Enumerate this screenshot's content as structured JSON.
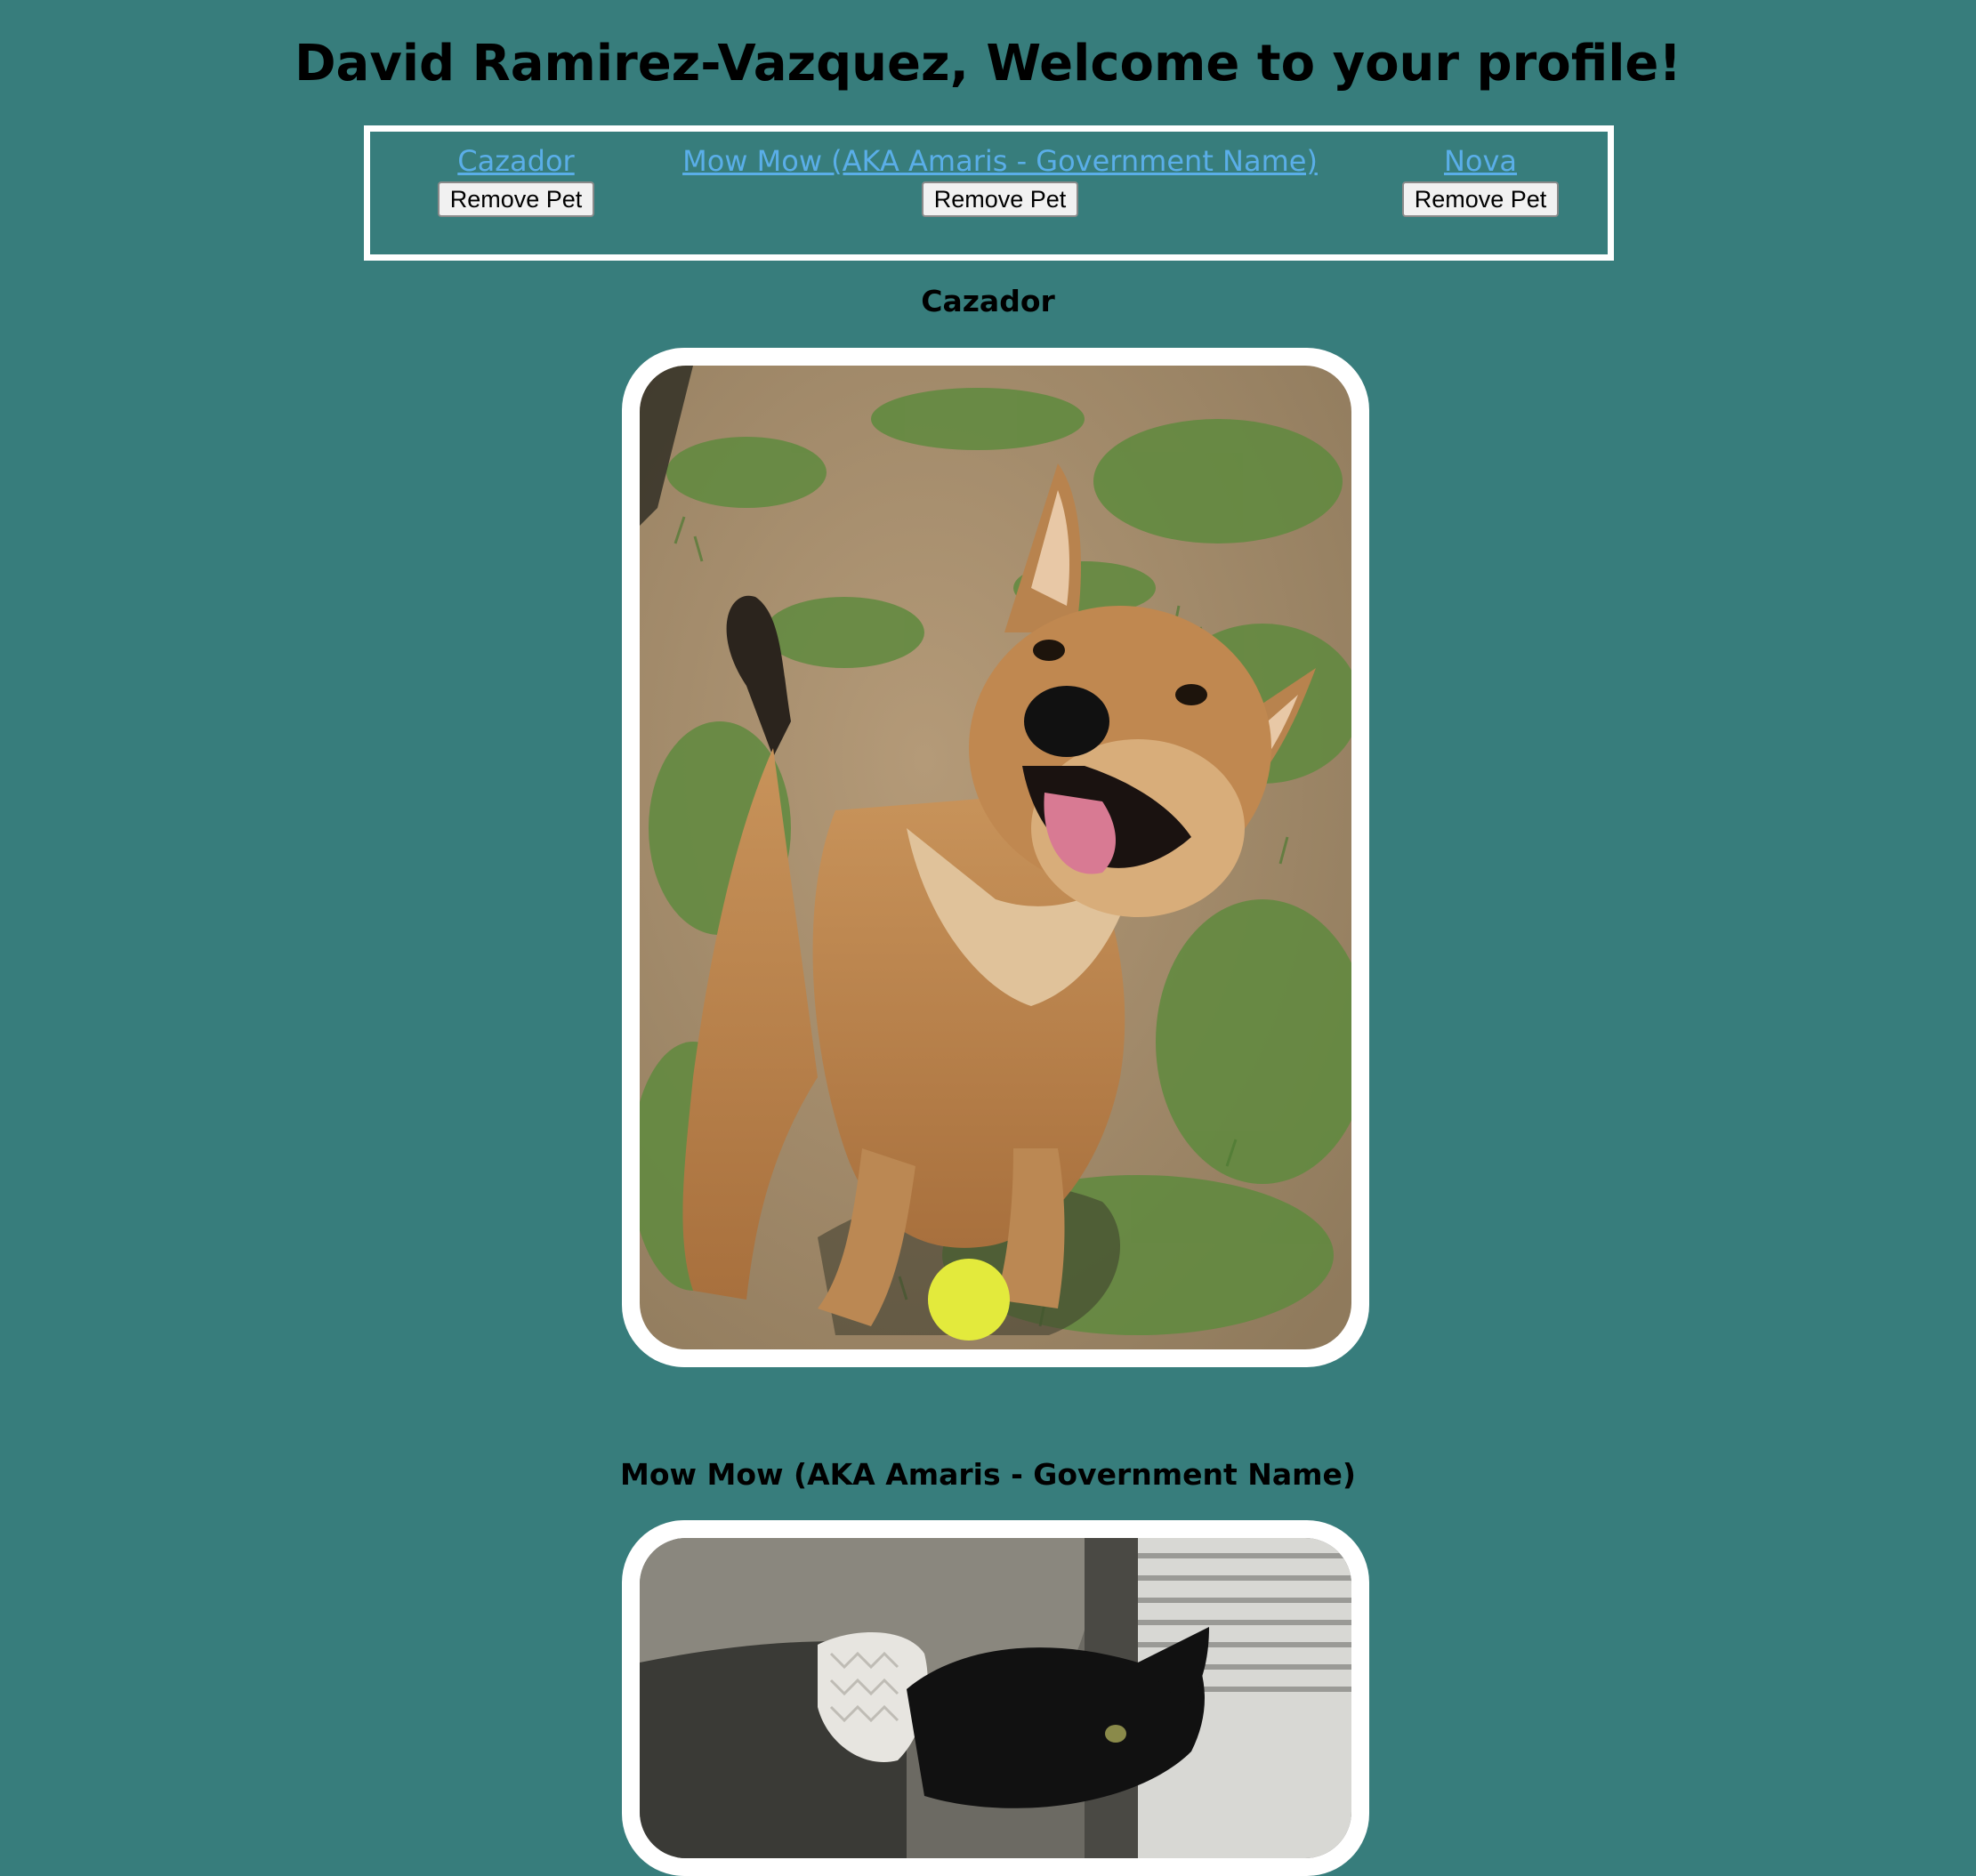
{
  "page": {
    "title": "David Ramirez-Vazquez, Welcome to your profile!"
  },
  "pet_nav": {
    "items": [
      {
        "name": "Cazador",
        "button_label": "Remove Pet"
      },
      {
        "name": "Mow Mow (AKA Amaris - Government Name)",
        "button_label": "Remove Pet"
      },
      {
        "name": "Nova",
        "button_label": "Remove Pet"
      }
    ]
  },
  "pets": [
    {
      "heading": "Cazador",
      "photo_subject": "dog-photo"
    },
    {
      "heading": "Mow Mow (AKA Amaris - Government Name)",
      "photo_subject": "cat-photo"
    }
  ],
  "colors": {
    "background": "#377d7c",
    "link": "#5aaee8",
    "frame": "#ffffff"
  }
}
